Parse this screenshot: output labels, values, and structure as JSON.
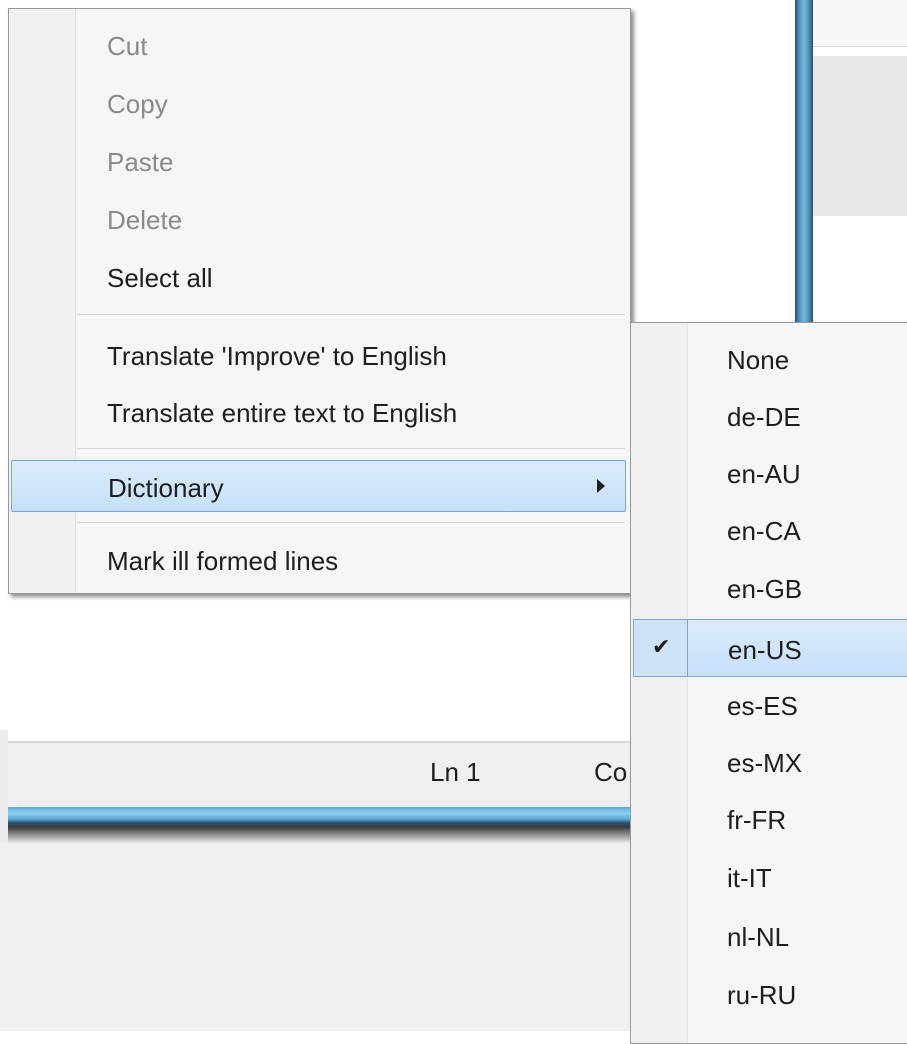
{
  "statusbar": {
    "line": "Ln 1",
    "col": "Co"
  },
  "context_menu": {
    "items": [
      {
        "label": "Cut",
        "enabled": false
      },
      {
        "label": "Copy",
        "enabled": false
      },
      {
        "label": "Paste",
        "enabled": false
      },
      {
        "label": "Delete",
        "enabled": false
      },
      {
        "label": "Select all",
        "enabled": true
      },
      {
        "label": "Translate 'Improve' to English",
        "enabled": true
      },
      {
        "label": "Translate entire text to English",
        "enabled": true
      },
      {
        "label": "Dictionary",
        "enabled": true,
        "has_submenu": true,
        "highlighted": true
      },
      {
        "label": "Mark ill formed lines",
        "enabled": true
      }
    ]
  },
  "dictionary_submenu": {
    "selected": "en-US",
    "items": [
      {
        "label": "None"
      },
      {
        "label": "de-DE"
      },
      {
        "label": "en-AU"
      },
      {
        "label": "en-CA"
      },
      {
        "label": "en-GB"
      },
      {
        "label": "en-US",
        "checked": true
      },
      {
        "label": "es-ES"
      },
      {
        "label": "es-MX"
      },
      {
        "label": "fr-FR"
      },
      {
        "label": "it-IT"
      },
      {
        "label": "nl-NL"
      },
      {
        "label": "ru-RU"
      }
    ]
  },
  "colors": {
    "highlight": "#c6e0fb",
    "highlight_border": "#7aa7d8",
    "disabled_text": "#8a8a8a",
    "window_border": "#4f8cb8"
  },
  "icons": {
    "submenu_arrow": "triangle-right",
    "check": "checkmark"
  }
}
